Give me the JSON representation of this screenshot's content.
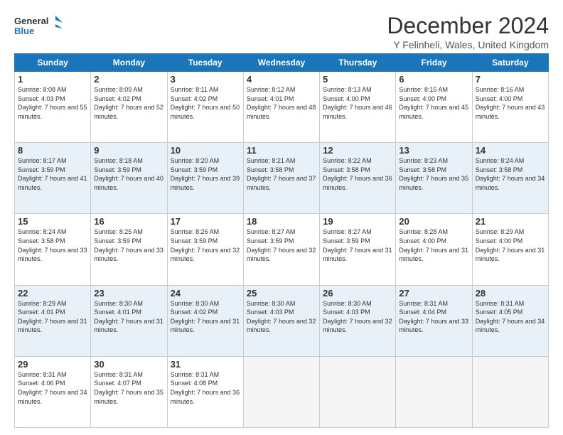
{
  "header": {
    "logo_line1": "General",
    "logo_line2": "Blue",
    "title": "December 2024",
    "subtitle": "Y Felinheli, Wales, United Kingdom"
  },
  "weekdays": [
    "Sunday",
    "Monday",
    "Tuesday",
    "Wednesday",
    "Thursday",
    "Friday",
    "Saturday"
  ],
  "weeks": [
    [
      {
        "day": "1",
        "sunrise": "Sunrise: 8:08 AM",
        "sunset": "Sunset: 4:03 PM",
        "daylight": "Daylight: 7 hours and 55 minutes."
      },
      {
        "day": "2",
        "sunrise": "Sunrise: 8:09 AM",
        "sunset": "Sunset: 4:02 PM",
        "daylight": "Daylight: 7 hours and 52 minutes."
      },
      {
        "day": "3",
        "sunrise": "Sunrise: 8:11 AM",
        "sunset": "Sunset: 4:02 PM",
        "daylight": "Daylight: 7 hours and 50 minutes."
      },
      {
        "day": "4",
        "sunrise": "Sunrise: 8:12 AM",
        "sunset": "Sunset: 4:01 PM",
        "daylight": "Daylight: 7 hours and 48 minutes."
      },
      {
        "day": "5",
        "sunrise": "Sunrise: 8:13 AM",
        "sunset": "Sunset: 4:00 PM",
        "daylight": "Daylight: 7 hours and 46 minutes."
      },
      {
        "day": "6",
        "sunrise": "Sunrise: 8:15 AM",
        "sunset": "Sunset: 4:00 PM",
        "daylight": "Daylight: 7 hours and 45 minutes."
      },
      {
        "day": "7",
        "sunrise": "Sunrise: 8:16 AM",
        "sunset": "Sunset: 4:00 PM",
        "daylight": "Daylight: 7 hours and 43 minutes."
      }
    ],
    [
      {
        "day": "8",
        "sunrise": "Sunrise: 8:17 AM",
        "sunset": "Sunset: 3:59 PM",
        "daylight": "Daylight: 7 hours and 41 minutes."
      },
      {
        "day": "9",
        "sunrise": "Sunrise: 8:18 AM",
        "sunset": "Sunset: 3:59 PM",
        "daylight": "Daylight: 7 hours and 40 minutes."
      },
      {
        "day": "10",
        "sunrise": "Sunrise: 8:20 AM",
        "sunset": "Sunset: 3:59 PM",
        "daylight": "Daylight: 7 hours and 39 minutes."
      },
      {
        "day": "11",
        "sunrise": "Sunrise: 8:21 AM",
        "sunset": "Sunset: 3:58 PM",
        "daylight": "Daylight: 7 hours and 37 minutes."
      },
      {
        "day": "12",
        "sunrise": "Sunrise: 8:22 AM",
        "sunset": "Sunset: 3:58 PM",
        "daylight": "Daylight: 7 hours and 36 minutes."
      },
      {
        "day": "13",
        "sunrise": "Sunrise: 8:23 AM",
        "sunset": "Sunset: 3:58 PM",
        "daylight": "Daylight: 7 hours and 35 minutes."
      },
      {
        "day": "14",
        "sunrise": "Sunrise: 8:24 AM",
        "sunset": "Sunset: 3:58 PM",
        "daylight": "Daylight: 7 hours and 34 minutes."
      }
    ],
    [
      {
        "day": "15",
        "sunrise": "Sunrise: 8:24 AM",
        "sunset": "Sunset: 3:58 PM",
        "daylight": "Daylight: 7 hours and 33 minutes."
      },
      {
        "day": "16",
        "sunrise": "Sunrise: 8:25 AM",
        "sunset": "Sunset: 3:59 PM",
        "daylight": "Daylight: 7 hours and 33 minutes."
      },
      {
        "day": "17",
        "sunrise": "Sunrise: 8:26 AM",
        "sunset": "Sunset: 3:59 PM",
        "daylight": "Daylight: 7 hours and 32 minutes."
      },
      {
        "day": "18",
        "sunrise": "Sunrise: 8:27 AM",
        "sunset": "Sunset: 3:59 PM",
        "daylight": "Daylight: 7 hours and 32 minutes."
      },
      {
        "day": "19",
        "sunrise": "Sunrise: 8:27 AM",
        "sunset": "Sunset: 3:59 PM",
        "daylight": "Daylight: 7 hours and 31 minutes."
      },
      {
        "day": "20",
        "sunrise": "Sunrise: 8:28 AM",
        "sunset": "Sunset: 4:00 PM",
        "daylight": "Daylight: 7 hours and 31 minutes."
      },
      {
        "day": "21",
        "sunrise": "Sunrise: 8:29 AM",
        "sunset": "Sunset: 4:00 PM",
        "daylight": "Daylight: 7 hours and 31 minutes."
      }
    ],
    [
      {
        "day": "22",
        "sunrise": "Sunrise: 8:29 AM",
        "sunset": "Sunset: 4:01 PM",
        "daylight": "Daylight: 7 hours and 31 minutes."
      },
      {
        "day": "23",
        "sunrise": "Sunrise: 8:30 AM",
        "sunset": "Sunset: 4:01 PM",
        "daylight": "Daylight: 7 hours and 31 minutes."
      },
      {
        "day": "24",
        "sunrise": "Sunrise: 8:30 AM",
        "sunset": "Sunset: 4:02 PM",
        "daylight": "Daylight: 7 hours and 31 minutes."
      },
      {
        "day": "25",
        "sunrise": "Sunrise: 8:30 AM",
        "sunset": "Sunset: 4:03 PM",
        "daylight": "Daylight: 7 hours and 32 minutes."
      },
      {
        "day": "26",
        "sunrise": "Sunrise: 8:30 AM",
        "sunset": "Sunset: 4:03 PM",
        "daylight": "Daylight: 7 hours and 32 minutes."
      },
      {
        "day": "27",
        "sunrise": "Sunrise: 8:31 AM",
        "sunset": "Sunset: 4:04 PM",
        "daylight": "Daylight: 7 hours and 33 minutes."
      },
      {
        "day": "28",
        "sunrise": "Sunrise: 8:31 AM",
        "sunset": "Sunset: 4:05 PM",
        "daylight": "Daylight: 7 hours and 34 minutes."
      }
    ],
    [
      {
        "day": "29",
        "sunrise": "Sunrise: 8:31 AM",
        "sunset": "Sunset: 4:06 PM",
        "daylight": "Daylight: 7 hours and 34 minutes."
      },
      {
        "day": "30",
        "sunrise": "Sunrise: 8:31 AM",
        "sunset": "Sunset: 4:07 PM",
        "daylight": "Daylight: 7 hours and 35 minutes."
      },
      {
        "day": "31",
        "sunrise": "Sunrise: 8:31 AM",
        "sunset": "Sunset: 4:08 PM",
        "daylight": "Daylight: 7 hours and 36 minutes."
      },
      null,
      null,
      null,
      null
    ]
  ]
}
